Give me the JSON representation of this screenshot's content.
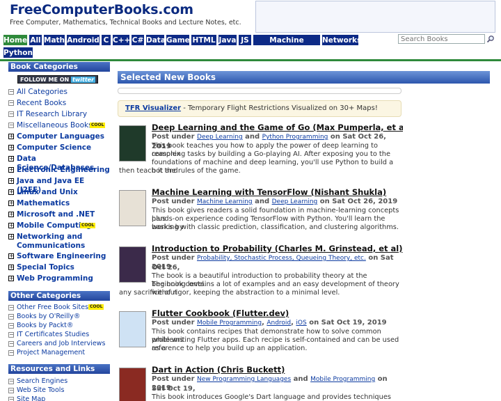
{
  "header": {
    "title": "FreeComputerBooks.com",
    "tagline": "Free Computer, Mathematics, Technical Books and Lecture Notes, etc."
  },
  "nav": {
    "tabs": [
      "Home",
      "All",
      "Math",
      "Android",
      "C",
      "C++",
      "C#",
      "Data",
      "Game",
      "HTML",
      "Java",
      "JS",
      "Machine Learning",
      "Networks",
      "Python"
    ],
    "active": "Home",
    "search_placeholder": "Search Books"
  },
  "sidebar": {
    "categories_heading": "Book Categories",
    "follow": {
      "text": "FOLLOW ME ON",
      "brand": "twitter"
    },
    "categories": [
      {
        "label": "All Categories",
        "type": "minus",
        "cool": false
      },
      {
        "label": "Recent Books",
        "type": "minus",
        "cool": false
      },
      {
        "label": "IT Research Library",
        "type": "minus",
        "cool": false
      },
      {
        "label": "Miscellaneous Books",
        "type": "minus",
        "cool": true
      },
      {
        "label": "Computer Languages",
        "type": "plus",
        "cool": false
      },
      {
        "label": "Computer Science",
        "type": "plus",
        "cool": false
      },
      {
        "label": "Data Science/Databases",
        "type": "plus",
        "cool": false
      },
      {
        "label": "Electronic Engineering",
        "type": "plus",
        "cool": false
      },
      {
        "label": "Java and Java EE (J2EE)",
        "type": "plus",
        "cool": false
      },
      {
        "label": "Linux and Unix",
        "type": "plus",
        "cool": false
      },
      {
        "label": "Mathematics",
        "type": "plus",
        "cool": false
      },
      {
        "label": "Microsoft and .NET",
        "type": "plus",
        "cool": false
      },
      {
        "label": "Mobile Computing",
        "type": "plus",
        "cool": true
      },
      {
        "label": "Networking and Communications",
        "type": "plus",
        "cool": false
      },
      {
        "label": "Software Engineering",
        "type": "plus",
        "cool": false
      },
      {
        "label": "Special Topics",
        "type": "plus",
        "cool": false
      },
      {
        "label": "Web Programming",
        "type": "plus",
        "cool": false
      }
    ],
    "cool_badge": "COOL",
    "other_heading": "Other Categories",
    "other": [
      {
        "label": "Other Free Book Sites",
        "cool": true
      },
      {
        "label": "Books by O'Reilly®",
        "cool": false
      },
      {
        "label": "Books by Packt®",
        "cool": false
      },
      {
        "label": "IT Certificates Studies",
        "cool": false
      },
      {
        "label": "Careers and Job Interviews",
        "cool": false
      },
      {
        "label": "Project Management",
        "cool": false
      }
    ],
    "resources_heading": "Resources and Links",
    "resources": [
      {
        "label": "Search Engines"
      },
      {
        "label": "Web Site Tools"
      },
      {
        "label": "Site Map"
      }
    ]
  },
  "main": {
    "section_title": "Selected New Books",
    "promo": {
      "link": "TFR Visualizer",
      "text": " - Temporary Flight Restrictions Visualized on 30+ Maps!"
    },
    "post_under": "Post under",
    "books": [
      {
        "title": "Deep Learning and the Game of Go (Max Pumperla, et al)",
        "tags": [
          "Deep Learning",
          "Python Programming"
        ],
        "seps": [
          " and "
        ],
        "date": " on Sat Oct 26, 2019",
        "desc": [
          "This book teaches you how to apply the power of deep learning to complex",
          "reasoning tasks by building a Go-playing AI. After exposing you to the",
          "foundations of machine and deep learning, you'll use Python to build a bot and",
          "then teach it the rules of the game."
        ],
        "cover_color": "#1f3a2a"
      },
      {
        "title": "Machine Learning with TensorFlow (Nishant Shukla)",
        "tags": [
          "Machine Learning",
          "Deep Learning"
        ],
        "seps": [
          " and "
        ],
        "date": " on Sat Oct 26, 2019",
        "desc": [
          "This book gives readers a solid foundation in machine-learning concepts plus",
          "hands-on experience coding TensorFlow with Python. You'll learn the basics by",
          "working with classic prediction, classification, and clustering algorithms."
        ],
        "cover_color": "#e7e1d6"
      },
      {
        "title": "Introduction to Probability (Charles M. Grinstead, et al)",
        "tags": [
          "Probability, Stochastic Process, Queueing Theory, etc."
        ],
        "seps": [],
        "date": " on Sat Oct 26,",
        "date2": "2019",
        "desc": [
          "The book is a beautiful introduction to probability theory at the beginning level.",
          "The book contains a lot of examples and an easy development of theory without",
          "any sacrifice of rigor, keeping the abstraction to a minimal level."
        ],
        "cover_color": "#3b2a4a"
      },
      {
        "title": "Flutter Cookbook (Flutter.dev)",
        "tags": [
          "Mobile Programming",
          "Android",
          "iOS"
        ],
        "seps": [
          ", ",
          ", "
        ],
        "date": " on Sat Oct 19, 2019",
        "desc": [
          "This book contains recipes that demonstrate how to solve common problems",
          "while writing Flutter apps. Each recipe is self-contained and can be used as a",
          "reference to help you build up an application."
        ],
        "cover_color": "#cfe2f4"
      },
      {
        "title": "Dart in Action (Chris Buckett)",
        "tags": [
          "New Programming Languages",
          "Mobile Programming"
        ],
        "seps": [
          " and "
        ],
        "date": " on Sat Oct 19,",
        "date2": "2019",
        "desc": [
          "This book introduces Google's Dart language and provides techniques and"
        ],
        "cover_color": "#8a2a22"
      }
    ]
  }
}
